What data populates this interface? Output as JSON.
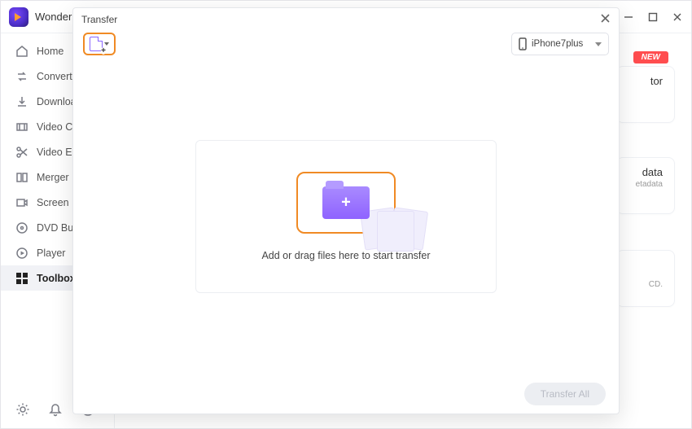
{
  "app": {
    "name_partial": "Wonder"
  },
  "window_controls": {
    "minimize": "minimize",
    "maximize": "maximize",
    "close": "close"
  },
  "sidebar": {
    "items": [
      {
        "label": "Home",
        "icon": "home-icon"
      },
      {
        "label": "Converter",
        "icon": "converter-icon"
      },
      {
        "label": "Downloader",
        "icon": "download-icon"
      },
      {
        "label": "Video Compressor",
        "icon": "compress-icon"
      },
      {
        "label": "Video Editor",
        "icon": "scissors-icon"
      },
      {
        "label": "Merger",
        "icon": "merge-icon"
      },
      {
        "label": "Screen Recorder",
        "icon": "record-icon"
      },
      {
        "label": "DVD Burner",
        "icon": "dvd-icon"
      },
      {
        "label": "Player",
        "icon": "play-icon"
      },
      {
        "label": "Toolbox",
        "icon": "toolbox-icon"
      }
    ],
    "active_index": 9
  },
  "content_stubs": {
    "new_badge": "NEW",
    "card1_line1": "tor",
    "card2_line1": "data",
    "card2_line2": "etadata",
    "card3_line1": "CD."
  },
  "modal": {
    "title": "Transfer",
    "device_selected": "iPhone7plus",
    "dropzone_text": "Add or drag files here to start transfer",
    "transfer_all_label": "Transfer All"
  }
}
